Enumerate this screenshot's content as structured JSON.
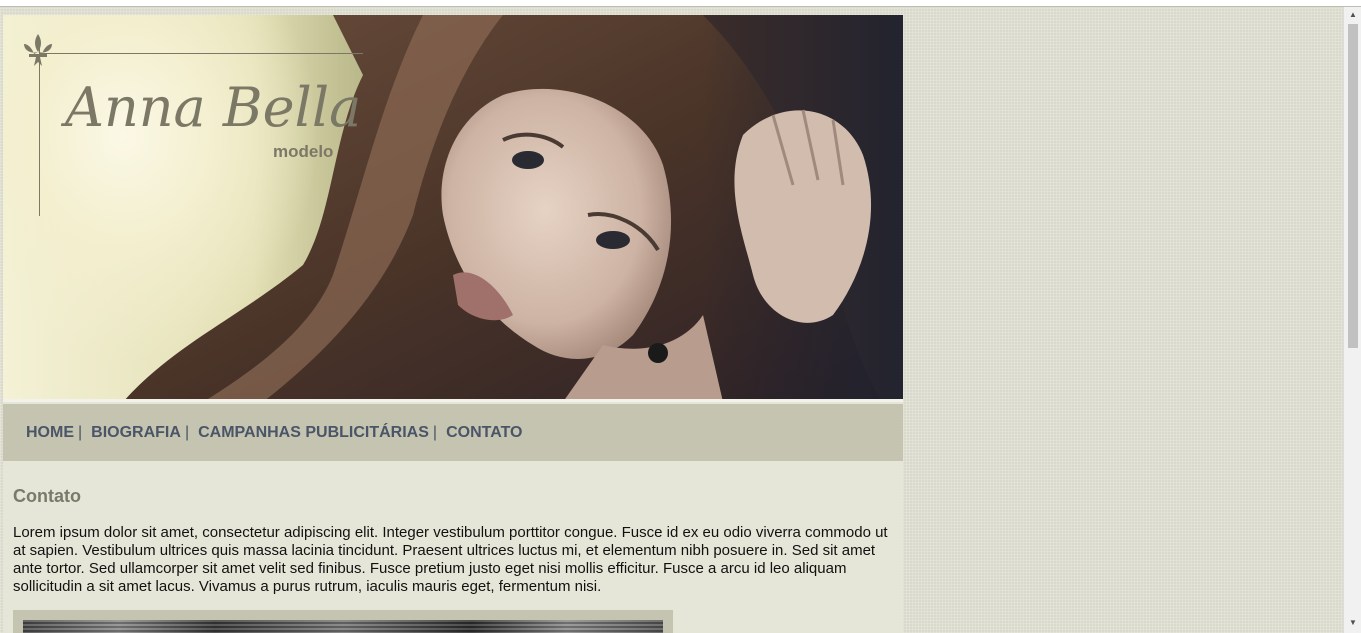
{
  "brand": {
    "name": "Anna Bella",
    "subtitle": "modelo"
  },
  "nav": {
    "items": [
      {
        "label": "HOME"
      },
      {
        "label": "BIOGRAFIA"
      },
      {
        "label": "CAMPANHAS PUBLICITÁRIAS"
      },
      {
        "label": "CONTATO"
      }
    ],
    "separator": "|"
  },
  "content": {
    "heading": "Contato",
    "paragraph": "Lorem ipsum dolor sit amet, consectetur adipiscing elit. Integer vestibulum porttitor congue. Fusce id ex eu odio viverra commodo ut at sapien. Vestibulum ultrices quis massa lacinia tincidunt. Praesent ultrices luctus mi, et elementum nibh posuere in. Sed sit amet ante tortor. Sed ullamcorper sit amet velit sed finibus. Fusce pretium justo eget nisi mollis efficitur. Fusce a arcu id leo aliquam sollicitudin a sit amet lacus. Vivamus a purus rutrum, iaculis mauris eget, fermentum nisi."
  },
  "colors": {
    "page_background": "#d9d9cc",
    "content_background": "#e6e6d8",
    "nav_background": "#c4c4b0",
    "nav_text": "#4a5568",
    "brand_text": "#7c7866"
  },
  "icons": {
    "logo_ornament": "fleur-de-lis-icon",
    "scroll_up": "triangle-up-icon",
    "scroll_down": "triangle-down-icon"
  }
}
